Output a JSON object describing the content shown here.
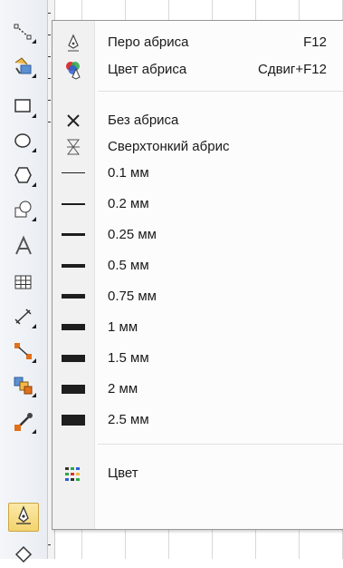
{
  "toolbox": {
    "tools": [
      {
        "name": "shape-tool-icon"
      },
      {
        "name": "crop-tool-icon"
      },
      {
        "name": "rectangle-tool-icon"
      },
      {
        "name": "ellipse-tool-icon"
      },
      {
        "name": "polygon-tool-icon"
      },
      {
        "name": "basic-shapes-tool-icon"
      },
      {
        "name": "text-tool-icon"
      },
      {
        "name": "table-tool-icon"
      },
      {
        "name": "dimension-tool-icon"
      },
      {
        "name": "connector-tool-icon"
      },
      {
        "name": "interactive-tool-icon"
      },
      {
        "name": "eyedropper-tool-icon"
      },
      {
        "name": "outline-pen-tool-icon",
        "active": true
      },
      {
        "name": "fill-tool-icon"
      }
    ]
  },
  "menu": {
    "items": [
      {
        "label": "Перо абриса",
        "shortcut": "F12",
        "icon": "outline-pen-icon"
      },
      {
        "label": "Цвет абриса",
        "shortcut": "Сдвиг+F12",
        "icon": "outline-color-icon"
      },
      {
        "label": "Без абриса",
        "shortcut": "",
        "icon": "no-outline-icon"
      },
      {
        "label": "Сверхтонкий абрис",
        "shortcut": "",
        "icon": "hairline-outline-icon"
      },
      {
        "label": "0.1 мм",
        "shortcut": "",
        "icon": "line-0.1mm-icon"
      },
      {
        "label": "0.2 мм",
        "shortcut": "",
        "icon": "line-0.2mm-icon"
      },
      {
        "label": "0.25 мм",
        "shortcut": "",
        "icon": "line-0.25mm-icon"
      },
      {
        "label": "0.5 мм",
        "shortcut": "",
        "icon": "line-0.5mm-icon"
      },
      {
        "label": "0.75 мм",
        "shortcut": "",
        "icon": "line-0.75mm-icon"
      },
      {
        "label": "1 мм",
        "shortcut": "",
        "icon": "line-1mm-icon"
      },
      {
        "label": "1.5 мм",
        "shortcut": "",
        "icon": "line-1.5mm-icon"
      },
      {
        "label": "2 мм",
        "shortcut": "",
        "icon": "line-2mm-icon"
      },
      {
        "label": "2.5 мм",
        "shortcut": "",
        "icon": "line-2.5mm-icon"
      },
      {
        "label": "Цвет",
        "shortcut": "",
        "icon": "color-docker-icon"
      }
    ]
  },
  "colors": {
    "active_tool_bg": "#f4d36f",
    "menu_bg": "#fcfcfc",
    "gutter_bg": "#f1f1f1"
  }
}
